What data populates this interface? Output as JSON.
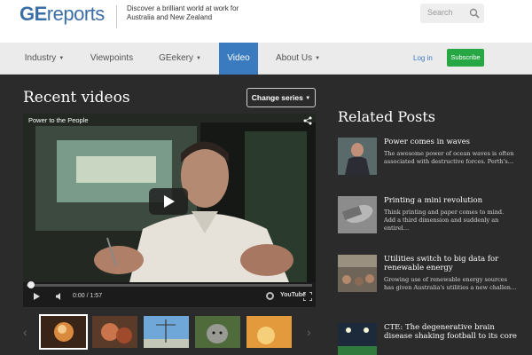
{
  "header": {
    "logo_ge": "GE",
    "logo_rest": "reports",
    "tagline": "Discover a brilliant world at work for Australia and New Zealand",
    "search_placeholder": "Search",
    "search_icon": "search-icon"
  },
  "nav": {
    "items": [
      {
        "label": "Industry",
        "dropdown": true
      },
      {
        "label": "Viewpoints",
        "dropdown": false
      },
      {
        "label": "GEekery",
        "dropdown": true
      },
      {
        "label": "Video",
        "dropdown": false,
        "active": true
      },
      {
        "label": "About Us",
        "dropdown": true
      }
    ],
    "login": "Log in",
    "subscribe": "Subscribe"
  },
  "main": {
    "title": "Recent videos",
    "change_series": "Change series",
    "player": {
      "video_title": "Power to the People",
      "time": "0:00 / 1:57",
      "youtube": "YouTube"
    }
  },
  "related": {
    "title": "Related Posts",
    "posts": [
      {
        "title": "Power comes in waves",
        "body": "The awesome power of ocean waves is often associated with destructive forces. Perth's…"
      },
      {
        "title": "Printing a mini revolution",
        "body": "Think printing and paper comes to mind. Add a third dimension and suddenly an entirel…"
      },
      {
        "title": "Utilities switch to big data for renewable energy",
        "body": "Growing use of renewable energy sources has given Australia's utilities a new challen…"
      },
      {
        "title": "CTE: The degenerative brain disease shaking football to its core",
        "body": ""
      }
    ]
  },
  "colors": {
    "brand_blue": "#3a7bbf",
    "subscribe_green": "#27a744",
    "page_bg": "#2b2b2b"
  }
}
